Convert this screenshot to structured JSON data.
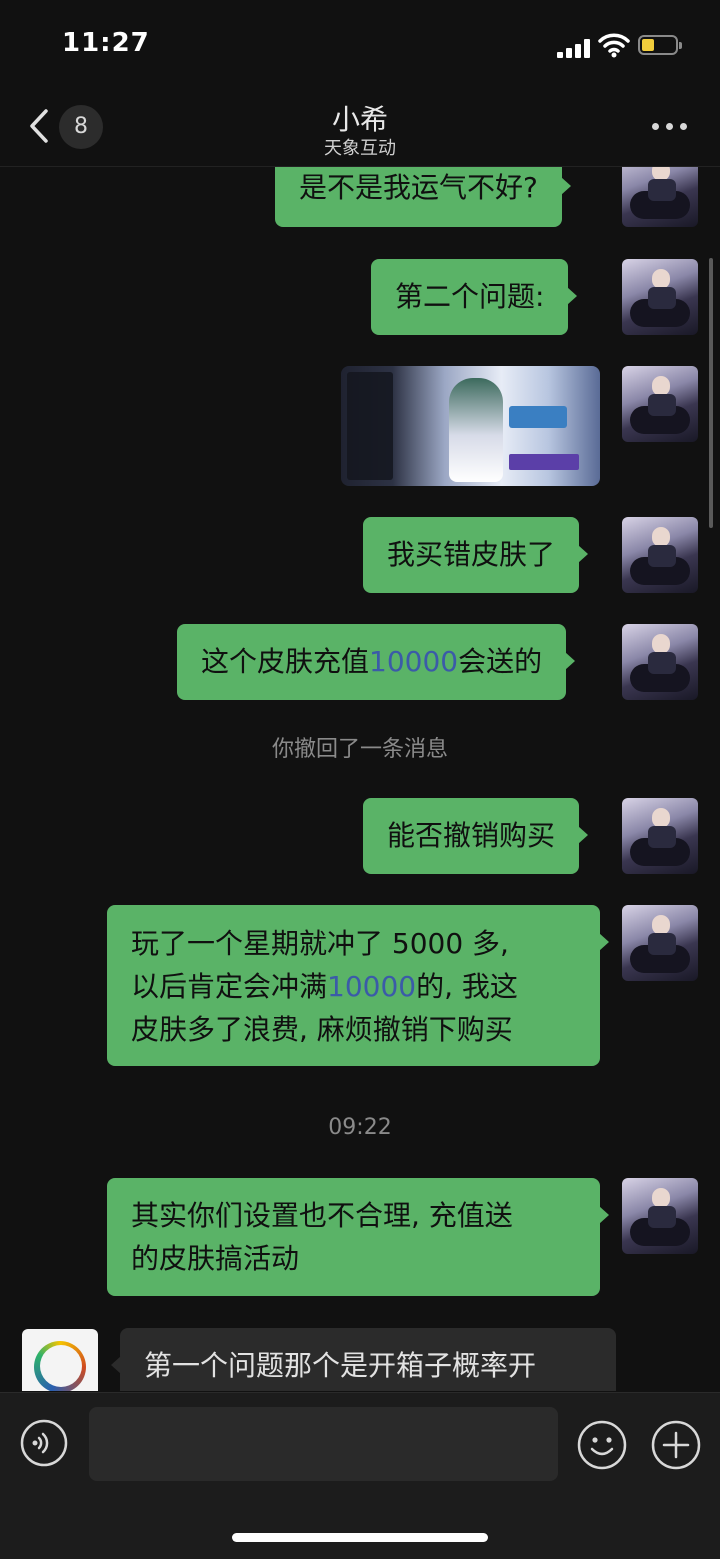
{
  "status": {
    "time": "11:27"
  },
  "nav": {
    "back_badge": "8",
    "title": "小希",
    "subtitle": "天象互动",
    "more_icon": "more-icon"
  },
  "messages": [
    {
      "from": "me",
      "text": "是不是我运气不好?"
    },
    {
      "from": "me",
      "text": "第二个问题:"
    },
    {
      "from": "me",
      "type": "image"
    },
    {
      "from": "me",
      "text": "我买错皮肤了"
    },
    {
      "from": "me",
      "text_before": "这个皮肤充值",
      "highlight": "10000",
      "text_after": "会送的"
    },
    {
      "system": "你撤回了一条消息"
    },
    {
      "from": "me",
      "text": "能否撤销购买"
    },
    {
      "from": "me",
      "line1": "玩了一个星期就冲了 5000 多,",
      "line2_before": "以后肯定会冲满",
      "line2_highlight": "10000",
      "line2_after": "的, 我这",
      "line3": "皮肤多了浪费, 麻烦撤销下购买"
    },
    {
      "time": "09:22"
    },
    {
      "from": "me",
      "line1": "其实你们设置也不合理, 充值送",
      "line2": "的皮肤搞活动"
    },
    {
      "from": "other",
      "line1": "第一个问题那个是开箱子概率开"
    }
  ],
  "colors": {
    "my_bubble": "#5ab367",
    "other_bubble": "#2b2b2b",
    "link": "#3b5ba8",
    "background": "#111111"
  },
  "input": {
    "voice_icon": "voice-icon",
    "emoji_icon": "emoji-icon",
    "plus_icon": "plus-icon"
  }
}
